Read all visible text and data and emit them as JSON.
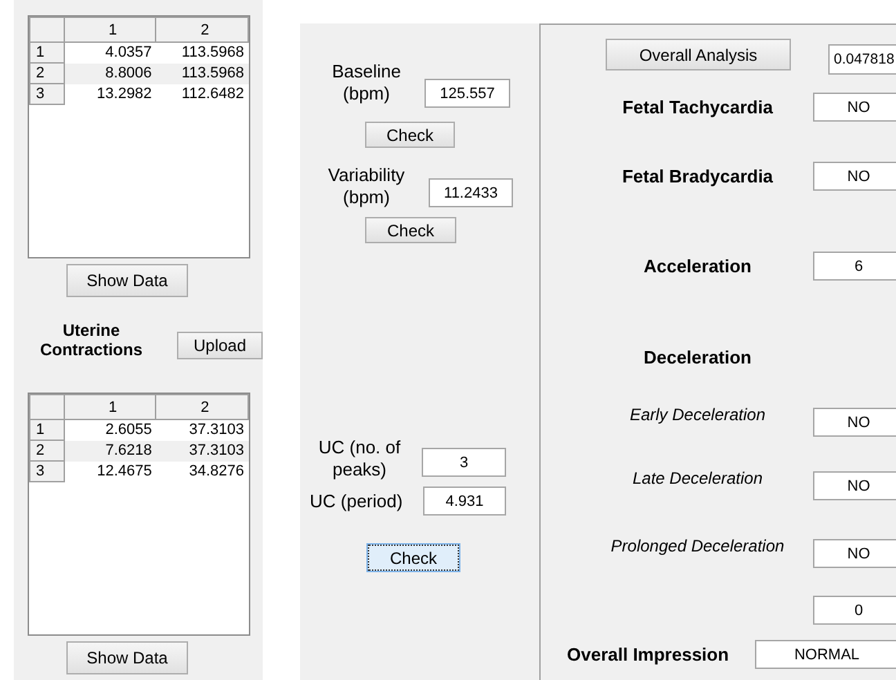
{
  "left_panel": {
    "fhr_table": {
      "columns": [
        "1",
        "2"
      ],
      "rows": [
        {
          "header": "1",
          "cells": [
            "4.0357",
            "113.5968"
          ]
        },
        {
          "header": "2",
          "cells": [
            "8.8006",
            "113.5968"
          ]
        },
        {
          "header": "3",
          "cells": [
            "13.2982",
            "112.6482"
          ]
        }
      ]
    },
    "fhr_show_button": "Show Data",
    "uc_label": "Uterine Contractions",
    "upload_button": "Upload",
    "uc_table": {
      "columns": [
        "1",
        "2"
      ],
      "rows": [
        {
          "header": "1",
          "cells": [
            "2.6055",
            "37.3103"
          ]
        },
        {
          "header": "2",
          "cells": [
            "7.6218",
            "37.3103"
          ]
        },
        {
          "header": "3",
          "cells": [
            "12.4675",
            "34.8276"
          ]
        }
      ]
    },
    "uc_show_button": "Show Data"
  },
  "middle_panel": {
    "baseline": {
      "label": "Baseline (bpm)",
      "value": "125.557",
      "button": "Check"
    },
    "variability": {
      "label": "Variability (bpm)",
      "value": "11.2433",
      "button": "Check"
    },
    "uc_peaks": {
      "label": "UC (no. of peaks)",
      "value": "3"
    },
    "uc_period": {
      "label": "UC (period)",
      "value": "4.931"
    },
    "uc_check": {
      "label": "Check",
      "focused": true
    }
  },
  "right_panel": {
    "analysis_button": "Overall Analysis",
    "analysis_value": "0.047818",
    "rows": [
      {
        "kind": "bold",
        "label": "Fetal Tachycardia",
        "value": "NO"
      },
      {
        "kind": "bold",
        "label": "Fetal Bradycardia",
        "value": "NO"
      },
      {
        "kind": "bold",
        "label": "Acceleration",
        "value": "6"
      },
      {
        "kind": "heading",
        "label": "Deceleration"
      },
      {
        "kind": "italic",
        "label": "Early Deceleration",
        "value": "NO"
      },
      {
        "kind": "italic",
        "label": "Late Deceleration",
        "value": "NO"
      },
      {
        "kind": "italic",
        "label": "Prolonged Deceleration",
        "value": "NO"
      },
      {
        "kind": "value",
        "value": "0"
      }
    ],
    "overall": {
      "label": "Overall Impression",
      "value": "NORMAL"
    }
  }
}
